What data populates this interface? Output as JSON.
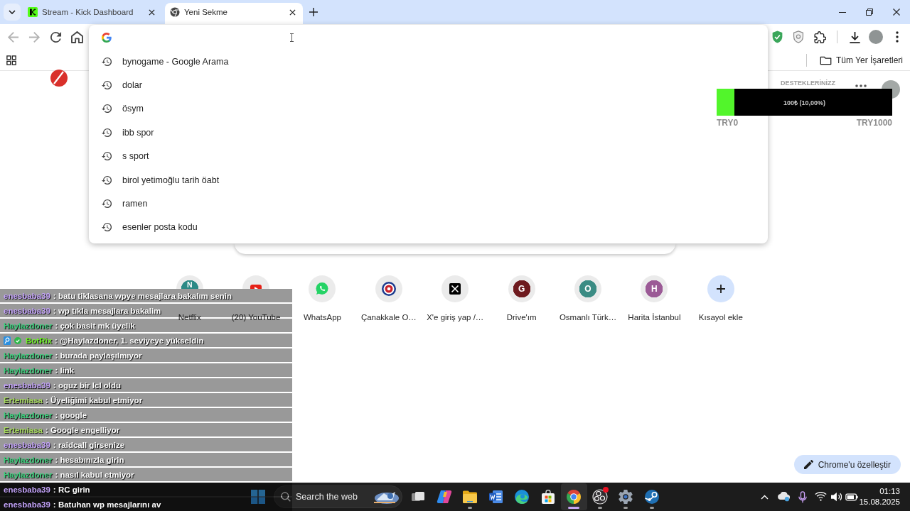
{
  "tabs": [
    {
      "title": "Stream - Kick Dashboard",
      "kind": "site",
      "selected": false
    },
    {
      "title": "Yeni Sekme",
      "kind": "newtab",
      "selected": true
    }
  ],
  "toolbar": {
    "nav_buttons": [
      {
        "kind": "back",
        "disabled": true
      },
      {
        "kind": "forward",
        "disabled": true
      },
      {
        "kind": "reload",
        "disabled": false
      },
      {
        "kind": "home",
        "disabled": false
      }
    ]
  },
  "bookmarks_bar": {
    "folder": "Tüm Yer İşaretleri"
  },
  "omnibox": {
    "suggestions": [
      "bynogame - Google Arama",
      "dolar",
      "ösym",
      "ibb spor",
      "s sport",
      "birol yetimoğlu tarih öabt",
      "ramen",
      "esenler posta kodu"
    ]
  },
  "new_tab_page": {
    "shortcuts": [
      {
        "kind": "letter",
        "letter": "N",
        "color": "#2b8a86",
        "label": "Netflix"
      },
      {
        "kind": "video",
        "label": "(20) YouTube"
      },
      {
        "kind": "chat",
        "label": "WhatsApp"
      },
      {
        "kind": "emblem",
        "label": "Çanakkale O…"
      },
      {
        "kind": "cross",
        "label": "X'e giriş yap /…"
      },
      {
        "kind": "letter",
        "letter": "G",
        "color": "#6e1a1e",
        "label": "Drive'ım"
      },
      {
        "kind": "letter",
        "letter": "O",
        "color": "#3b8c84",
        "label": "Osmanlı Türk…"
      },
      {
        "kind": "letter",
        "letter": "H",
        "color": "#9b5a96",
        "label": "Harita İstanbul"
      },
      {
        "kind": "add",
        "label": "Kısayol ekle"
      }
    ],
    "customize_button": "Chrome'u özelleştir"
  },
  "stream_overlay": {
    "supporters_title": "DESTEKLERİNİZZ",
    "goal": {
      "level": 0.1,
      "reading": "100₺ (10,00%)",
      "min_label": "TRY0",
      "max_label": "TRY1000"
    },
    "chat": [
      {
        "kind": "user",
        "user": "enesbaba39",
        "color": "#c4a4fa",
        "text": ": batu tiklasana wpye mesajlara bakalım senin"
      },
      {
        "kind": "user",
        "user": "enesbaba39",
        "color": "#c4a4fa",
        "text": ": wp tıkla mesajlara bakalim"
      },
      {
        "kind": "user",
        "user": "Haylazdoner",
        "color": "#3ccf7c",
        "text": ": çok basit mk üyelik"
      },
      {
        "kind": "bot",
        "user": "BotRix",
        "color": "#72f52a",
        "text": ": @Haylazdoner, 1. seviyeye yükseldin"
      },
      {
        "kind": "user",
        "user": "Haylazdoner",
        "color": "#3ccf7c",
        "text": ": burada paylaşılmıyor"
      },
      {
        "kind": "user",
        "user": "Haylazdoner",
        "color": "#3ccf7c",
        "text": ": link"
      },
      {
        "kind": "user",
        "user": "enesbaba39",
        "color": "#c4a4fa",
        "text": ": oguz bir lcl oldu"
      },
      {
        "kind": "user",
        "user": "Ertemiasa",
        "color": "#a8dc5e",
        "text": ": Üyeliğimi kabul etmiyor"
      },
      {
        "kind": "user",
        "user": "Haylazdoner",
        "color": "#3ccf7c",
        "text": ": google"
      },
      {
        "kind": "user",
        "user": "Ertemiasa",
        "color": "#a8dc5e",
        "text": ": Google engelliyor"
      },
      {
        "kind": "user",
        "user": "enesbaba39",
        "color": "#c4a4fa",
        "text": ": raidcall girsenize"
      },
      {
        "kind": "user",
        "user": "Haylazdoner",
        "color": "#3ccf7c",
        "text": ": hesabınızla girin"
      },
      {
        "kind": "user",
        "user": "Haylazdoner",
        "color": "#3ccf7c",
        "text": ": nasıl kabul etmiyor"
      },
      {
        "kind": "user",
        "user": "enesbaba39",
        "color": "#c4a4fa",
        "text": ": RC girin"
      },
      {
        "kind": "user",
        "user": "enesbaba39",
        "color": "#c4a4fa",
        "text": ": Batuhan wp mesajlarını av"
      }
    ]
  },
  "taskbar": {
    "search_placeholder": "Search the web",
    "apps": [
      {
        "kind": "taskview",
        "running": false,
        "selected": false,
        "notification": false
      },
      {
        "kind": "assistant",
        "running": false,
        "selected": false,
        "notification": false
      },
      {
        "kind": "folder",
        "running": true,
        "selected": false,
        "notification": false
      },
      {
        "kind": "document",
        "running": false,
        "selected": false,
        "notification": false
      },
      {
        "kind": "wave",
        "running": false,
        "selected": false,
        "notification": false
      },
      {
        "kind": "store",
        "running": false,
        "selected": false,
        "notification": false
      },
      {
        "kind": "browser",
        "running": true,
        "selected": true,
        "notification": false
      },
      {
        "kind": "recorder",
        "running": true,
        "selected": false,
        "notification": true
      },
      {
        "kind": "settings",
        "running": true,
        "selected": false,
        "notification": false
      },
      {
        "kind": "launcher",
        "running": true,
        "selected": false,
        "notification": false
      }
    ],
    "time": "01:13",
    "date": "15.08.2025"
  }
}
